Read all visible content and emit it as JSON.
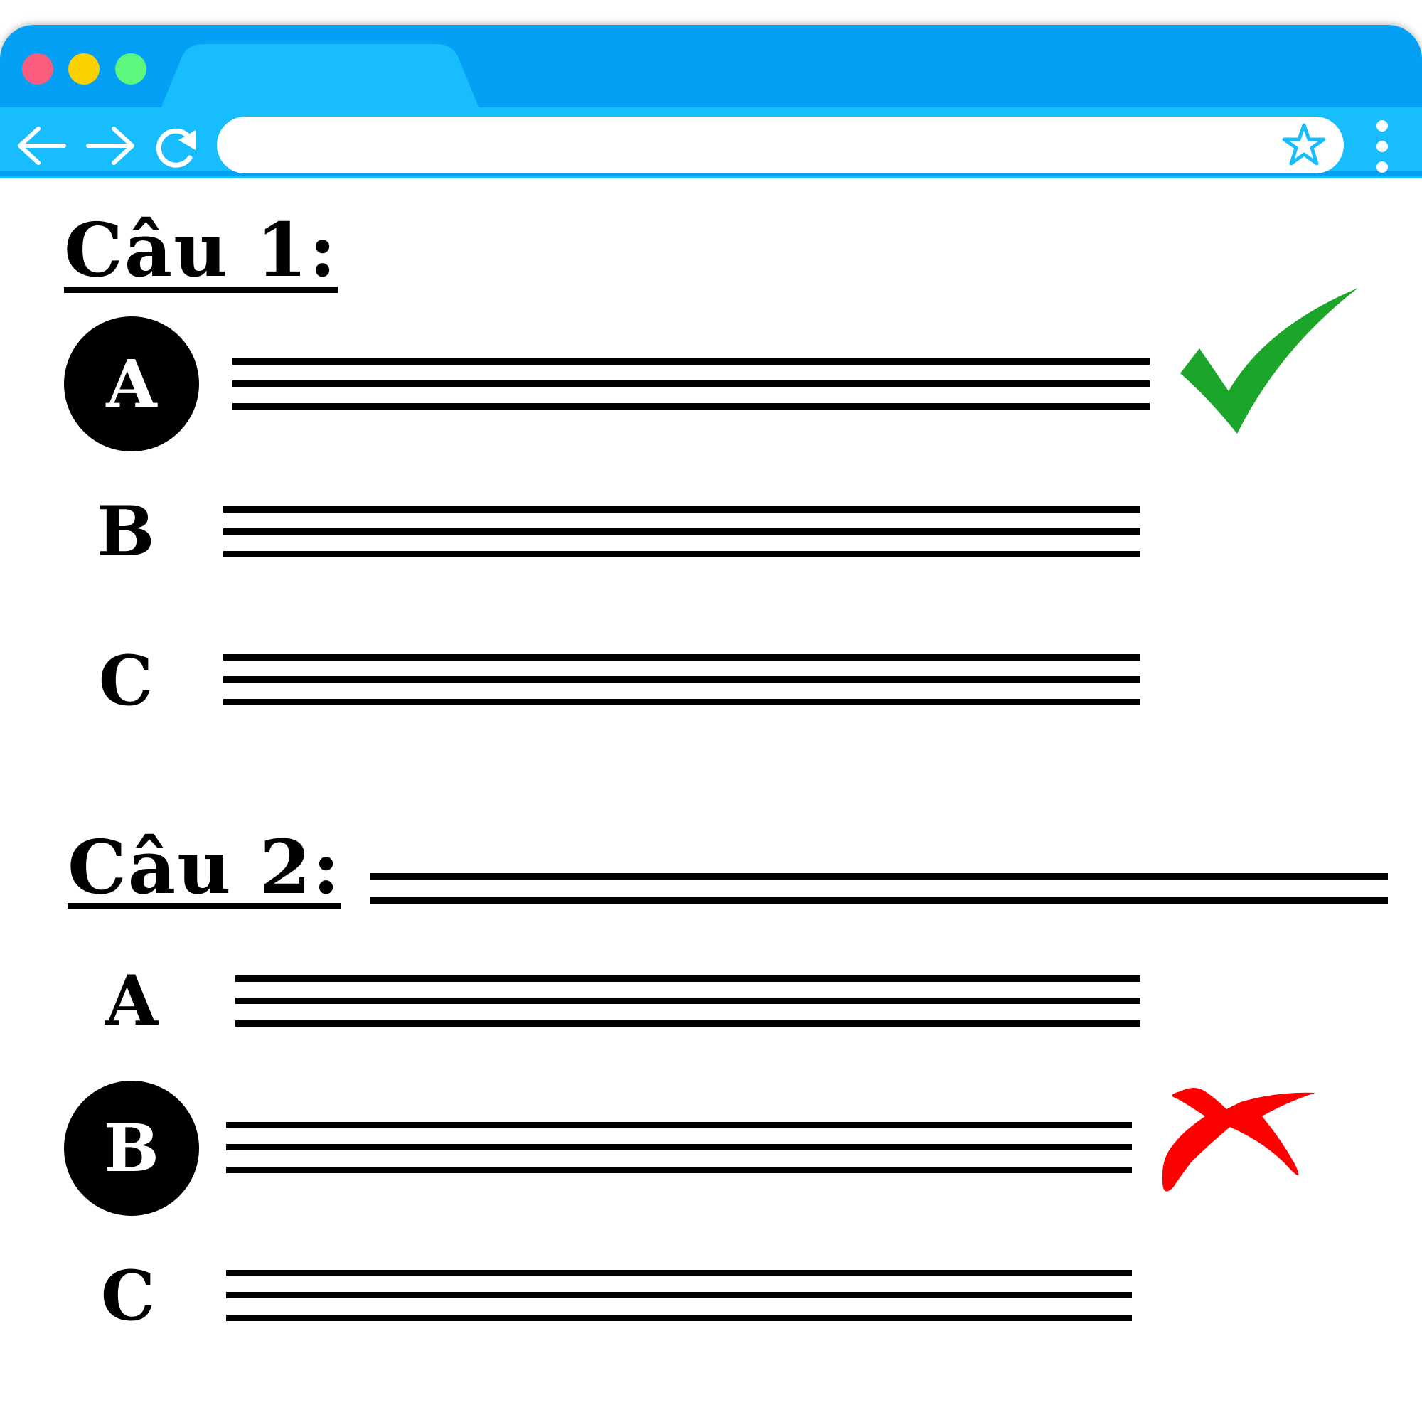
{
  "browser": {
    "traffic_lights": {
      "close_color": "#fc5c7d",
      "minimize_color": "#fdd000",
      "maximize_color": "#5cf77c"
    },
    "titlebar_color": "#03a0f6",
    "toolbar_color": "#17bdfd",
    "icons": {
      "back": "arrow-left-icon",
      "forward": "arrow-right-icon",
      "reload": "reload-icon",
      "bookmark": "star-icon",
      "menu": "kebab-menu-icon"
    },
    "address_bar": {
      "value": ""
    }
  },
  "questions": [
    {
      "title": "Câu 1:",
      "options": [
        {
          "letter": "A",
          "selected": true,
          "mark": "correct"
        },
        {
          "letter": "B",
          "selected": false,
          "mark": ""
        },
        {
          "letter": "C",
          "selected": false,
          "mark": ""
        }
      ]
    },
    {
      "title": "Câu 2:",
      "options": [
        {
          "letter": "A",
          "selected": false,
          "mark": ""
        },
        {
          "letter": "B",
          "selected": true,
          "mark": "wrong"
        },
        {
          "letter": "C",
          "selected": false,
          "mark": ""
        }
      ]
    }
  ],
  "marks": {
    "correct_color": "#1ba62b",
    "wrong_color": "#fd0000"
  }
}
